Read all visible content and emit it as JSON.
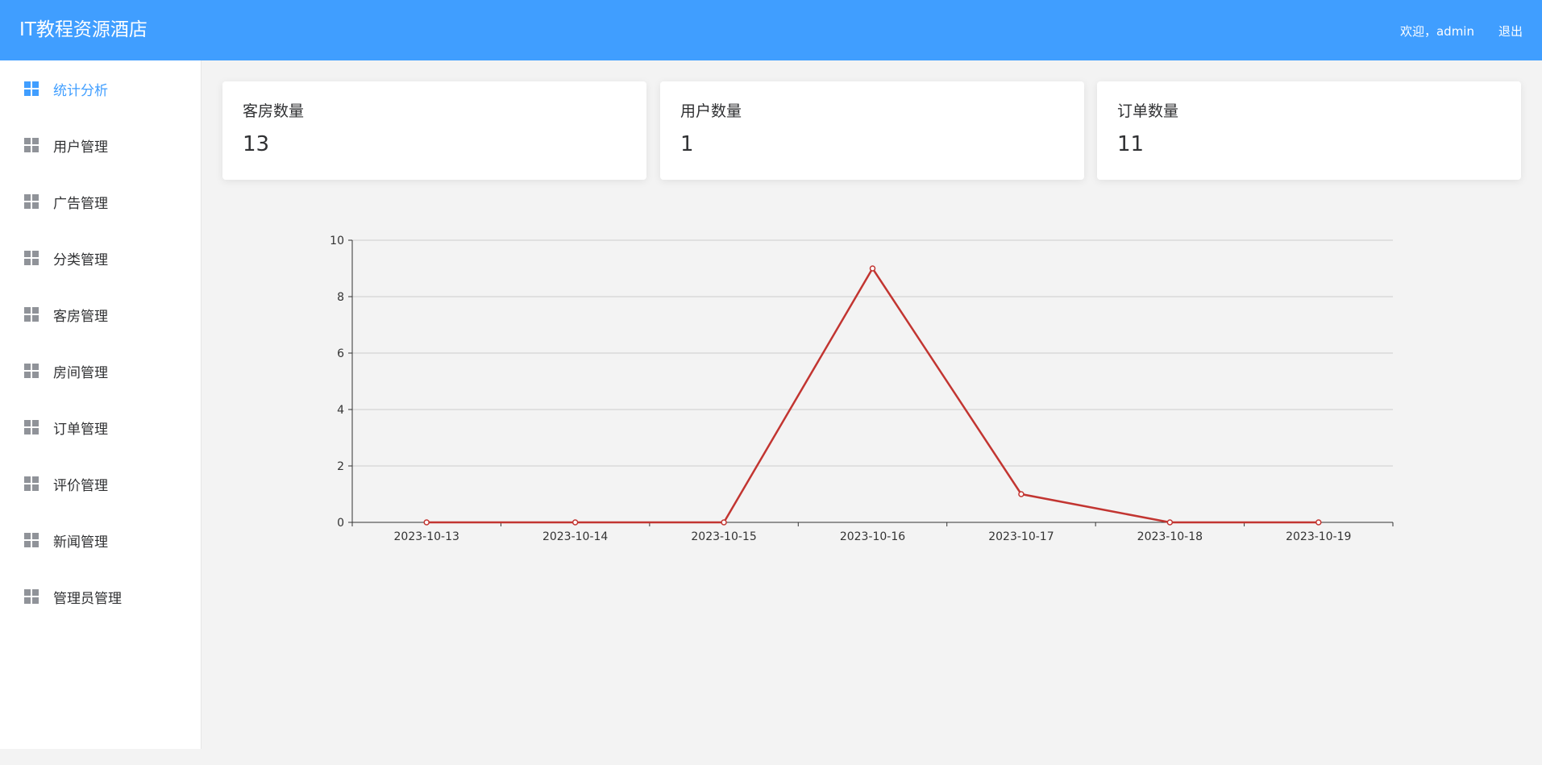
{
  "header": {
    "title": "IT教程资源酒店",
    "welcome": "欢迎，admin",
    "logout": "退出"
  },
  "sidebar": {
    "items": [
      {
        "label": "统计分析",
        "active": true
      },
      {
        "label": "用户管理"
      },
      {
        "label": "广告管理"
      },
      {
        "label": "分类管理"
      },
      {
        "label": "客房管理"
      },
      {
        "label": "房间管理"
      },
      {
        "label": "订单管理"
      },
      {
        "label": "评价管理"
      },
      {
        "label": "新闻管理"
      },
      {
        "label": "管理员管理"
      }
    ]
  },
  "stats": [
    {
      "label": "客房数量",
      "value": "13"
    },
    {
      "label": "用户数量",
      "value": "1"
    },
    {
      "label": "订单数量",
      "value": "11"
    }
  ],
  "colors": {
    "header": "#409eff",
    "active": "#409eff",
    "line": "#c23531"
  },
  "chart_data": {
    "type": "line",
    "x": [
      "2023-10-13",
      "2023-10-14",
      "2023-10-15",
      "2023-10-16",
      "2023-10-17",
      "2023-10-18",
      "2023-10-19"
    ],
    "series": [
      {
        "values": [
          0,
          0,
          0,
          9,
          1,
          0,
          0
        ]
      }
    ],
    "ylim": [
      0,
      10
    ],
    "yticks": [
      0,
      2,
      4,
      6,
      8,
      10
    ],
    "grid": true
  }
}
